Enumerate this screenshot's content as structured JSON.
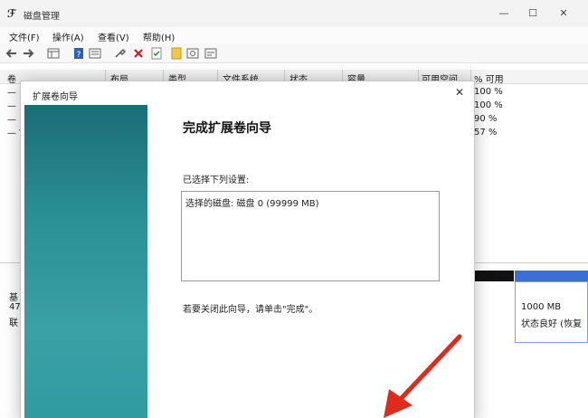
{
  "window": {
    "title": "磁盘管理",
    "app_icon": "disk-management-icon",
    "controls": [
      "—",
      "☐",
      "✕"
    ]
  },
  "menu": [
    "文件(F)",
    "操作(A)",
    "查看(V)",
    "帮助(H)"
  ],
  "toolbar_icons": [
    "back-icon",
    "forward-icon",
    "grid-icon",
    "help-icon",
    "list-icon",
    "connect-icon",
    "delete-icon",
    "check-icon",
    "folder-icon",
    "search-icon",
    "properties-icon"
  ],
  "columns": [
    "卷",
    "布局",
    "类型",
    "文件系统",
    "状态",
    "容量",
    "可用空间",
    "% 可用"
  ],
  "volume_rows": [
    {
      "marker": "— (",
      "pct": "100 %"
    },
    {
      "marker": "— (",
      "pct": "100 %"
    },
    {
      "marker": "— (",
      "pct": "90 %"
    },
    {
      "marker": "— V",
      "pct": "57 %"
    }
  ],
  "disk": {
    "label1": "基",
    "label2": "47",
    "label3": "联",
    "partition_size": "1000 MB",
    "partition_status": "状态良好 (恢复"
  },
  "wizard": {
    "title": "扩展卷向导",
    "heading": "完成扩展卷向导",
    "subheading": "已选择下列设置:",
    "settings_text": "选择的磁盘: 磁盘 0 (99999 MB)",
    "hint": "若要关闭此向导，请单击\"完成\"。",
    "close": "✕"
  },
  "colors": {
    "banner_top": "#1b6d76",
    "banner_mid": "#3aa1a6",
    "arrow": "#e02a1c",
    "partition_blue": "#3b6fd6"
  }
}
